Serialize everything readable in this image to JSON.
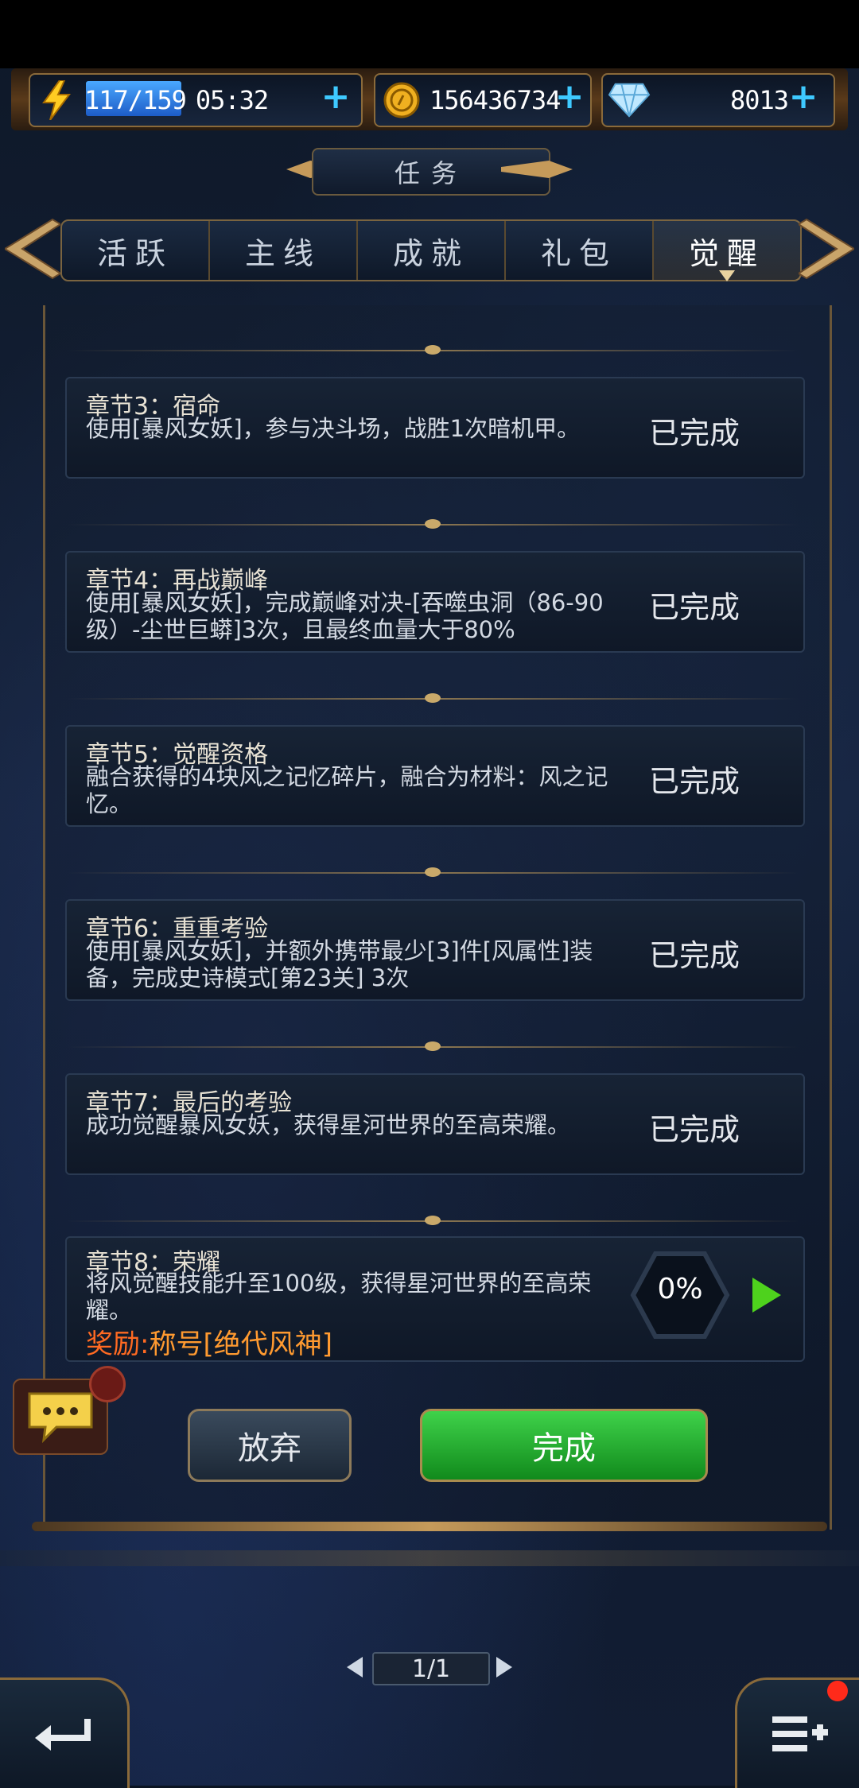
{
  "resources": {
    "energy": "117/159",
    "energy_timer": "05:32",
    "gold": "156436734",
    "diamonds": "8013",
    "plus_symbol": "+"
  },
  "header": {
    "title": "任务"
  },
  "tabs": [
    {
      "label": "活跃",
      "active": false
    },
    {
      "label": "主线",
      "active": false
    },
    {
      "label": "成就",
      "active": false
    },
    {
      "label": "礼包",
      "active": false
    },
    {
      "label": "觉醒",
      "active": true
    }
  ],
  "quests": [
    {
      "title": "章节3：宿命",
      "desc": "使用[暴风女妖]，参与决斗场，战胜1次暗机甲。",
      "status": "已完成"
    },
    {
      "title": "章节4：再战巅峰",
      "desc": "使用[暴风女妖]，完成巅峰对决-[吞噬虫洞（86-90级）-尘世巨蟒]3次，且最终血量大于80%",
      "status": "已完成"
    },
    {
      "title": "章节5：觉醒资格",
      "desc": "融合获得的4块风之记忆碎片，融合为材料：风之记忆。",
      "status": "已完成"
    },
    {
      "title": "章节6：重重考验",
      "desc": "使用[暴风女妖]，并额外携带最少[3]件[风属性]装备，完成史诗模式[第23关] 3次",
      "status": "已完成"
    },
    {
      "title": "章节7：最后的考验",
      "desc": "成功觉醒暴风女妖，获得星河世界的至高荣耀。",
      "status": "已完成"
    }
  ],
  "current_quest": {
    "title": "章节8：荣耀",
    "desc": "将风觉醒技能升至100级，获得星河世界的至高荣耀。",
    "reward_label": "奖励:",
    "reward_value": "称号[绝代风神]",
    "progress": "0%",
    "progress_value": 0
  },
  "buttons": {
    "abandon": "放弃",
    "complete": "完成"
  },
  "pager": {
    "text": "1/1"
  },
  "colors": {
    "accent_green": "#4ed21d",
    "reward_orange": "#ff6a22",
    "frame_gold": "#8a6a3a"
  }
}
